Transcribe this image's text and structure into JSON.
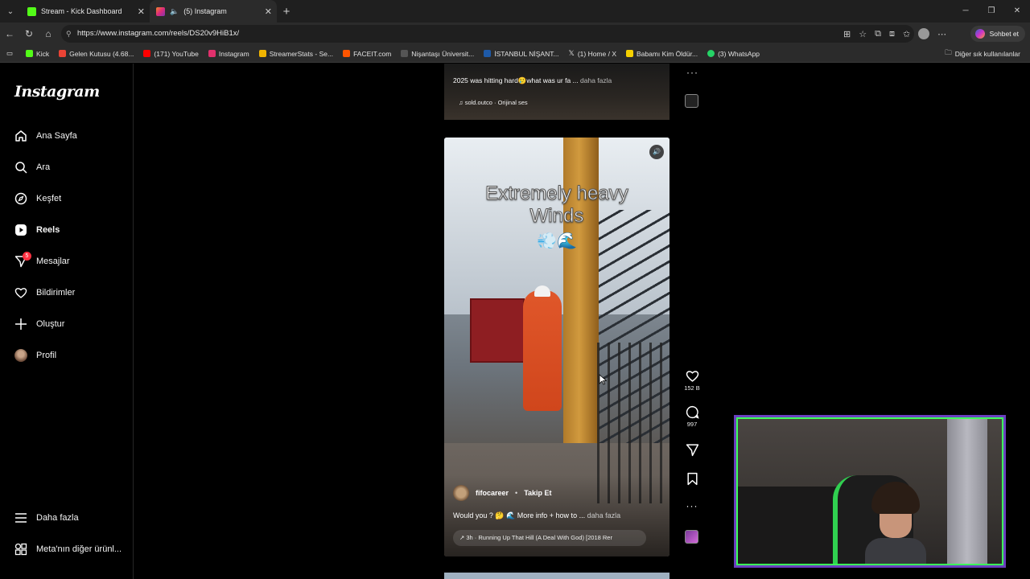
{
  "browser": {
    "tabs": [
      {
        "label": "Stream - Kick Dashboard",
        "favicon_color": "#53fc18"
      },
      {
        "label": "(5) Instagram",
        "favicon_color": "#e1306c"
      }
    ],
    "url": "https://www.instagram.com/reels/DS20v9HiB1x/",
    "chat_button": "Sohbet et",
    "bookmarks": [
      {
        "label": "Kick",
        "color": "#53fc18"
      },
      {
        "label": "Gelen Kutusu (4.68...",
        "color": "#ea4335"
      },
      {
        "label": "(171) YouTube",
        "color": "#ff0000"
      },
      {
        "label": "Instagram",
        "color": "#e1306c"
      },
      {
        "label": "StreamerStats - Se...",
        "color": "#f0b400"
      },
      {
        "label": "FACEIT.com",
        "color": "#ff5500"
      },
      {
        "label": "Nişantaşı Üniversit...",
        "color": "#555555"
      },
      {
        "label": "İSTANBUL NİŞANT...",
        "color": "#1e5aa8"
      },
      {
        "label": "(1) Home / X",
        "color": "#ffffff"
      },
      {
        "label": "Babamı Kim Öldür...",
        "color": "#f5d000"
      },
      {
        "label": "(3) WhatsApp",
        "color": "#25d366"
      }
    ],
    "other_bookmarks": "Diğer sık kullanılanlar"
  },
  "instagram": {
    "logo": "Instagram",
    "nav": [
      {
        "label": "Ana Sayfa",
        "icon": "home-icon"
      },
      {
        "label": "Ara",
        "icon": "search-icon"
      },
      {
        "label": "Keşfet",
        "icon": "compass-icon"
      },
      {
        "label": "Reels",
        "icon": "reels-icon",
        "active": true
      },
      {
        "label": "Mesajlar",
        "icon": "messenger-icon",
        "badge": "5"
      },
      {
        "label": "Bildirimler",
        "icon": "heart-icon"
      },
      {
        "label": "Oluştur",
        "icon": "plus-icon"
      },
      {
        "label": "Profil",
        "icon": "avatar"
      }
    ],
    "more": "Daha fazla",
    "meta": "Meta'nın diğer ürünl..."
  },
  "previous_reel": {
    "caption": "2025 was hitting hard🥲what was ur fa ...",
    "more": "daha fazla",
    "audio": "sold.outco · Orijinal ses"
  },
  "reel": {
    "overlay_line1": "Extremely heavy",
    "overlay_line2": "Winds",
    "overlay_emoji": "💨🌊",
    "author": "fifocareer",
    "follow": "Takip Et",
    "caption": "Would you ? 🤔 🌊 More info + how to  ...",
    "more": "daha fazla",
    "audio": "↗ 3h · Running Up That Hill (A Deal With God) [2018 Rer",
    "likes": "152 B",
    "comments": "997"
  }
}
